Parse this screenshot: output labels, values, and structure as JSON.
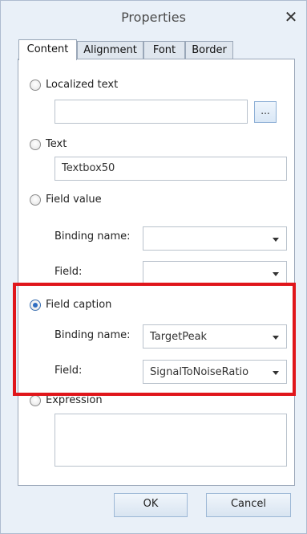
{
  "window": {
    "title": "Properties"
  },
  "tabs": [
    {
      "label": "Content",
      "active": true
    },
    {
      "label": "Alignment",
      "active": false
    },
    {
      "label": "Font",
      "active": false
    },
    {
      "label": "Border",
      "active": false
    }
  ],
  "localized_text": {
    "label": "Localized text",
    "value": "",
    "browse_label": "..."
  },
  "text": {
    "label": "Text",
    "value": "Textbox50"
  },
  "field_value": {
    "label": "Field value",
    "binding_label": "Binding name:",
    "binding_value": "",
    "field_label": "Field:",
    "field_value": ""
  },
  "field_caption": {
    "label": "Field caption",
    "checked": true,
    "binding_label": "Binding name:",
    "binding_value": "TargetPeak",
    "field_label": "Field:",
    "field_value": "SignalToNoiseRatio"
  },
  "expression": {
    "label": "Expression",
    "value": ""
  },
  "buttons": {
    "ok": "OK",
    "cancel": "Cancel"
  },
  "colors": {
    "highlight": "#e0161b",
    "background": "#e9f0f8",
    "accent": "#2f6dc1"
  }
}
